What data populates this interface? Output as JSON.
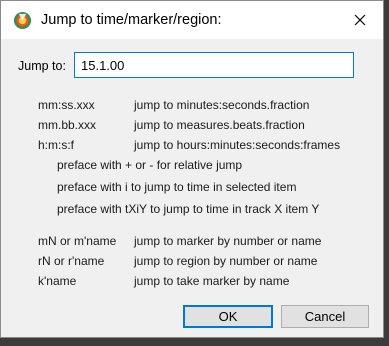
{
  "window": {
    "title": "Jump to time/marker/region:",
    "app_icon": "reaper-logo-icon",
    "close_icon": "close-icon"
  },
  "jump": {
    "label": "Jump to:",
    "value": "15.1.00"
  },
  "help": {
    "formats": [
      {
        "format": "mm:ss.xxx",
        "description": "jump to minutes:seconds.fraction"
      },
      {
        "format": "mm.bb.xxx",
        "description": "jump to measures.beats.fraction"
      },
      {
        "format": "h:m:s:f",
        "description": "jump to hours:minutes:seconds:frames"
      }
    ],
    "prefaces": [
      "preface with + or - for relative jump",
      "preface with i to jump to time in selected item",
      "preface with tXiY to jump to time in track X item Y"
    ],
    "named": [
      {
        "format": "mN or m'name",
        "description": "jump to marker by number or name"
      },
      {
        "format": "rN or r'name",
        "description": "jump to region by number or name"
      },
      {
        "format": "k'name",
        "description": "jump to take marker by name"
      }
    ]
  },
  "buttons": {
    "ok": "OK",
    "cancel": "Cancel"
  },
  "colors": {
    "focus_accent": "#0078d7",
    "dialog_background": "#f0f0f0",
    "titlebar_background": "#ffffff"
  }
}
